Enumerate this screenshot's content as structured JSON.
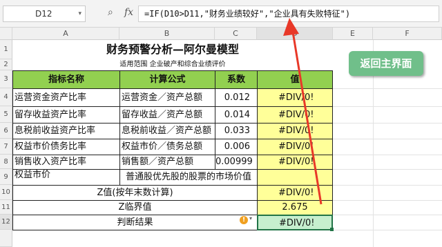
{
  "formula_bar": {
    "name_box": "D12",
    "zoom_icon": "magnifier-icon",
    "fx_label": "fx",
    "formula": "=IF(D10>D11,\"财务业绩较好\",\"企业具有失败特征\")"
  },
  "columns": [
    "A",
    "B",
    "C",
    "D",
    "E",
    "F"
  ],
  "rows": [
    "1",
    "2",
    "3",
    "4",
    "5",
    "6",
    "7",
    "8",
    "9",
    "10",
    "11",
    "12"
  ],
  "sheet": {
    "title": "财务预警分析—阿尔曼模型",
    "scope": "适用范围  企业破产和综合业绩评价",
    "headers": {
      "name": "指标名称",
      "formula": "计算公式",
      "coef": "系数",
      "value": "值"
    },
    "indicators": [
      {
        "name": "运营资金资产比率",
        "formula": "运营资金／资产总额",
        "coef": "0.012",
        "value": "#DIV/0!"
      },
      {
        "name": "留存收益资产比率",
        "formula": "留存收益／资产总额",
        "coef": "0.014",
        "value": "#DIV/0!"
      },
      {
        "name": "息税前收益资产比率",
        "formula": "息税前收益／资产总额",
        "coef": "0.033",
        "value": "#DIV/0!"
      },
      {
        "name": "权益市价债务比率",
        "formula": "权益市价／债务总额",
        "coef": "0.006",
        "value": "#DIV/0!"
      },
      {
        "name": "销售收入资产比率",
        "formula": "销售额／资产总额",
        "coef": "0.00999",
        "value": "#DIV/0!"
      }
    ],
    "equity_market_value": {
      "name": "权益市价",
      "desc": "普通股优先股的股票的市场价值"
    },
    "z_value": {
      "label": "Z值(按年末数计算)",
      "value": "#DIV/0!"
    },
    "z_threshold": {
      "label": "Z临界值",
      "value": "2.675"
    },
    "judgement": {
      "label": "判断结果",
      "value": "#DIV/0!"
    }
  },
  "back_button": "返回主界面",
  "colors": {
    "header_green": "#92d050",
    "value_yellow": "#ffff99",
    "button_green": "#70bf8a",
    "arrow_red": "#e83828"
  }
}
